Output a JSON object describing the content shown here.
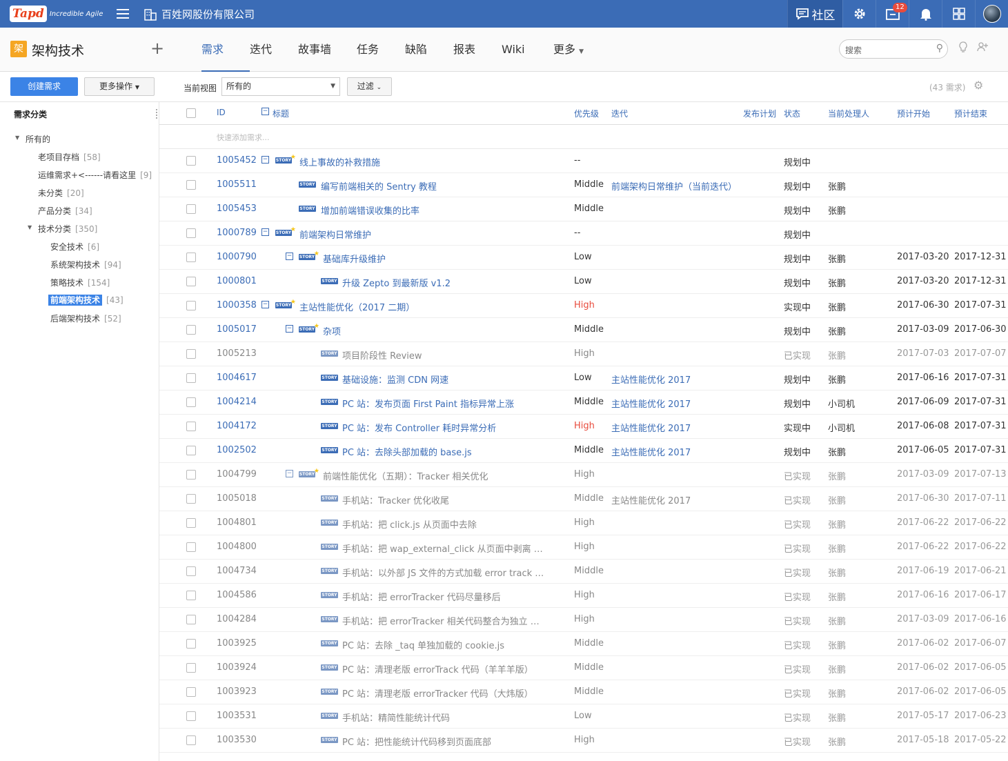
{
  "topbar": {
    "logo": "Tapd",
    "tagline": "Incredible Agile",
    "company": "百姓网股份有限公司",
    "community": "社区",
    "inbox_badge": "12"
  },
  "project": {
    "icon_char": "架",
    "name": "架构技术"
  },
  "nav": {
    "items": [
      "需求",
      "迭代",
      "故事墙",
      "任务",
      "缺陷",
      "报表",
      "Wiki",
      "更多"
    ],
    "active": 0
  },
  "search": {
    "placeholder": "搜索"
  },
  "toolbar": {
    "create": "创建需求",
    "more_ops": "更多操作",
    "view_label": "当前视图",
    "view_value": "所有的",
    "filter": "过滤",
    "count": "(43 需求)"
  },
  "sidebar": {
    "title": "需求分类",
    "items": [
      {
        "label": "所有的",
        "count": ""
      },
      {
        "label": "老项目存档",
        "count": "[58]"
      },
      {
        "label": "运维需求+<------请看这里",
        "count": "[9]"
      },
      {
        "label": "未分类",
        "count": "[20]"
      },
      {
        "label": "产品分类",
        "count": "[34]"
      },
      {
        "label": "技术分类",
        "count": "[350]"
      },
      {
        "label": "安全技术",
        "count": "[6]"
      },
      {
        "label": "系统架构技术",
        "count": "[94]"
      },
      {
        "label": "策略技术",
        "count": "[154]"
      },
      {
        "label": "前端架构技术",
        "count": "[43]"
      },
      {
        "label": "后端架构技术",
        "count": "[52]"
      }
    ]
  },
  "table": {
    "headers": {
      "id": "ID",
      "title": "标题",
      "priority": "优先级",
      "iteration": "迭代",
      "release": "发布计划",
      "status": "状态",
      "owner": "当前处理人",
      "start": "预计开始",
      "end": "预计结束"
    },
    "quick_add": "快速添加需求...",
    "story_tag": "STORY",
    "rows": [
      {
        "id": "1005452",
        "title": "线上事故的补救措施",
        "priority": "--",
        "iteration": "",
        "status": "规划中",
        "owner": "",
        "start": "",
        "end": ""
      },
      {
        "id": "1005511",
        "title": "编写前端相关的 Sentry 教程",
        "priority": "Middle",
        "iteration": "前端架构日常维护（当前迭代）",
        "status": "规划中",
        "owner": "张鹏",
        "start": "",
        "end": ""
      },
      {
        "id": "1005453",
        "title": "增加前端错误收集的比率",
        "priority": "Middle",
        "iteration": "",
        "status": "规划中",
        "owner": "张鹏",
        "start": "",
        "end": ""
      },
      {
        "id": "1000789",
        "title": "前端架构日常维护",
        "priority": "--",
        "iteration": "",
        "status": "规划中",
        "owner": "",
        "start": "",
        "end": ""
      },
      {
        "id": "1000790",
        "title": "基础库升级维护",
        "priority": "Low",
        "iteration": "",
        "status": "规划中",
        "owner": "张鹏",
        "start": "2017-03-20",
        "end": "2017-12-31"
      },
      {
        "id": "1000801",
        "title": "升级 Zepto 到最新版 v1.2",
        "priority": "Low",
        "iteration": "",
        "status": "规划中",
        "owner": "张鹏",
        "start": "2017-03-20",
        "end": "2017-12-31"
      },
      {
        "id": "1000358",
        "title": "主站性能优化（2017 二期）",
        "priority": "High",
        "iteration": "",
        "status": "实现中",
        "owner": "张鹏",
        "start": "2017-06-30",
        "end": "2017-07-31"
      },
      {
        "id": "1005017",
        "title": "杂项",
        "priority": "Middle",
        "iteration": "",
        "status": "规划中",
        "owner": "张鹏",
        "start": "2017-03-09",
        "end": "2017-06-30"
      },
      {
        "id": "1005213",
        "title": "项目阶段性 Review",
        "priority": "High",
        "iteration": "",
        "status": "已实现",
        "owner": "张鹏",
        "start": "2017-07-03",
        "end": "2017-07-07"
      },
      {
        "id": "1004617",
        "title": "基础设施：监测 CDN 网速",
        "priority": "Low",
        "iteration": "主站性能优化 2017",
        "status": "规划中",
        "owner": "张鹏",
        "start": "2017-06-16",
        "end": "2017-07-31"
      },
      {
        "id": "1004214",
        "title": "PC 站：发布页面 First Paint 指标异常上涨",
        "priority": "Middle",
        "iteration": "主站性能优化 2017",
        "status": "规划中",
        "owner": "小司机",
        "start": "2017-06-09",
        "end": "2017-07-31"
      },
      {
        "id": "1004172",
        "title": "PC 站：发布 Controller 耗时异常分析",
        "priority": "High",
        "iteration": "主站性能优化 2017",
        "status": "实现中",
        "owner": "小司机",
        "start": "2017-06-08",
        "end": "2017-07-31"
      },
      {
        "id": "1002502",
        "title": "PC 站：去除头部加载的 base.js",
        "priority": "Middle",
        "iteration": "主站性能优化 2017",
        "status": "规划中",
        "owner": "张鹏",
        "start": "2017-06-05",
        "end": "2017-07-31"
      },
      {
        "id": "1004799",
        "title": "前端性能优化（五期）：Tracker 相关优化",
        "priority": "High",
        "iteration": "",
        "status": "已实现",
        "owner": "张鹏",
        "start": "2017-03-09",
        "end": "2017-07-13"
      },
      {
        "id": "1005018",
        "title": "手机站：Tracker 优化收尾",
        "priority": "Middle",
        "iteration": "主站性能优化 2017",
        "status": "已实现",
        "owner": "张鹏",
        "start": "2017-06-30",
        "end": "2017-07-11"
      },
      {
        "id": "1004801",
        "title": "手机站：把 click.js 从页面中去除",
        "priority": "High",
        "iteration": "",
        "status": "已实现",
        "owner": "张鹏",
        "start": "2017-06-22",
        "end": "2017-06-22"
      },
      {
        "id": "1004800",
        "title": "手机站：把 wap_external_click 从页面中剥离 …",
        "priority": "High",
        "iteration": "",
        "status": "已实现",
        "owner": "张鹏",
        "start": "2017-06-22",
        "end": "2017-06-22"
      },
      {
        "id": "1004734",
        "title": "手机站：以外部 JS 文件的方式加载 error track …",
        "priority": "Middle",
        "iteration": "",
        "status": "已实现",
        "owner": "张鹏",
        "start": "2017-06-19",
        "end": "2017-06-21"
      },
      {
        "id": "1004586",
        "title": "手机站：把 errorTracker 代码尽量移后",
        "priority": "High",
        "iteration": "",
        "status": "已实现",
        "owner": "张鹏",
        "start": "2017-06-16",
        "end": "2017-06-17"
      },
      {
        "id": "1004284",
        "title": "手机站：把 errorTracker 相关代码整合为独立 …",
        "priority": "High",
        "iteration": "",
        "status": "已实现",
        "owner": "张鹏",
        "start": "2017-03-09",
        "end": "2017-06-16"
      },
      {
        "id": "1003925",
        "title": "PC 站：去除 _taq 单独加载的 cookie.js",
        "priority": "Middle",
        "iteration": "",
        "status": "已实现",
        "owner": "张鹏",
        "start": "2017-06-02",
        "end": "2017-06-07"
      },
      {
        "id": "1003924",
        "title": "PC 站：清理老版 errorTrack 代码（羊羊羊版）",
        "priority": "Middle",
        "iteration": "",
        "status": "已实现",
        "owner": "张鹏",
        "start": "2017-06-02",
        "end": "2017-06-05"
      },
      {
        "id": "1003923",
        "title": "PC 站：清理老版 errorTracker 代码（大炜版）",
        "priority": "Middle",
        "iteration": "",
        "status": "已实现",
        "owner": "张鹏",
        "start": "2017-06-02",
        "end": "2017-06-05"
      },
      {
        "id": "1003531",
        "title": "手机站：精简性能统计代码",
        "priority": "Low",
        "iteration": "",
        "status": "已实现",
        "owner": "张鹏",
        "start": "2017-05-17",
        "end": "2017-06-23"
      },
      {
        "id": "1003530",
        "title": "PC 站：把性能统计代码移到页面底部",
        "priority": "High",
        "iteration": "",
        "status": "已实现",
        "owner": "张鹏",
        "start": "2017-05-18",
        "end": "2017-05-22"
      }
    ]
  }
}
